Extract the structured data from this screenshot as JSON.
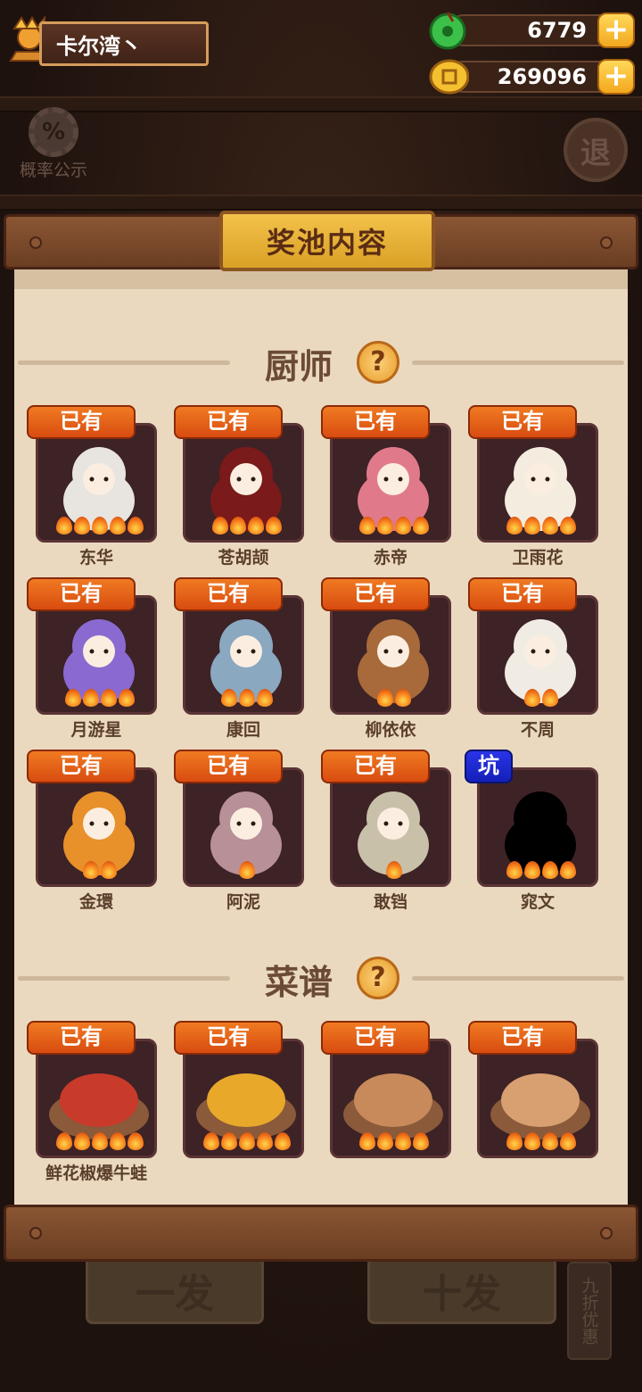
{
  "player": {
    "name": "卡尔湾丶"
  },
  "currency": [
    {
      "icon": "jade-coin-icon",
      "value": "6779"
    },
    {
      "icon": "gold-coin-icon",
      "value": "269096"
    }
  ],
  "left_button": {
    "icon_symbol": "%",
    "label": "概率公示"
  },
  "exit_button": {
    "label": "退"
  },
  "panel": {
    "title": "奖池内容"
  },
  "sections": [
    {
      "title": "厨师",
      "help": "?",
      "items": [
        {
          "badge": "已有",
          "name": "东华",
          "stars": 5,
          "special": false,
          "color": "#e8e4e0"
        },
        {
          "badge": "已有",
          "name": "苍胡颉",
          "stars": 4,
          "special": false,
          "color": "#7a1a1a"
        },
        {
          "badge": "已有",
          "name": "赤帝",
          "stars": 4,
          "special": false,
          "color": "#e07a8a"
        },
        {
          "badge": "已有",
          "name": "卫雨花",
          "stars": 4,
          "special": false,
          "color": "#f5ece0"
        },
        {
          "badge": "已有",
          "name": "月游星",
          "stars": 4,
          "special": false,
          "color": "#8a6ad0"
        },
        {
          "badge": "已有",
          "name": "康回",
          "stars": 3,
          "special": false,
          "color": "#8aa8c0"
        },
        {
          "badge": "已有",
          "name": "柳依依",
          "stars": 2,
          "special": false,
          "color": "#a86a3a"
        },
        {
          "badge": "已有",
          "name": "不周",
          "stars": 2,
          "special": false,
          "color": "#f0ece4"
        },
        {
          "badge": "已有",
          "name": "金環",
          "stars": 2,
          "special": false,
          "color": "#e8902a"
        },
        {
          "badge": "已有",
          "name": "阿泥",
          "stars": 1,
          "special": false,
          "color": "#b89098"
        },
        {
          "badge": "已有",
          "name": "敢铛",
          "stars": 1,
          "special": false,
          "color": "#c8c0a8"
        },
        {
          "badge": "坑",
          "name": "窕文",
          "stars": 4,
          "special": true,
          "color": "#000000"
        }
      ]
    },
    {
      "title": "菜谱",
      "help": "?",
      "items": [
        {
          "badge": "已有",
          "name": "鲜花椒爆牛蛙",
          "stars": 5,
          "special": false,
          "color": "#c83a2a"
        },
        {
          "badge": "已有",
          "name": "",
          "stars": 5,
          "special": false,
          "color": "#e8a82a"
        },
        {
          "badge": "已有",
          "name": "",
          "stars": 4,
          "special": false,
          "color": "#c88a5a"
        },
        {
          "badge": "已有",
          "name": "",
          "stars": 4,
          "special": false,
          "color": "#d8a070"
        }
      ]
    }
  ],
  "bottom_buttons": [
    {
      "label": "一发"
    },
    {
      "label": "十发"
    }
  ],
  "discount_tag": {
    "label": "九折优惠"
  }
}
